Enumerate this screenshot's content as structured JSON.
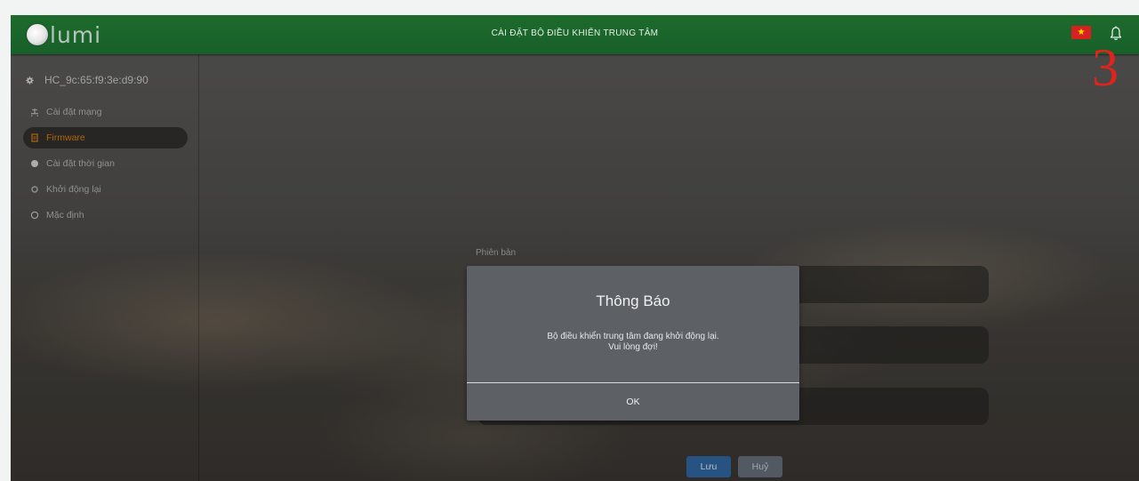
{
  "header": {
    "logo_text": "lumi",
    "title": "CÀI ĐẶT BỘ ĐIỀU KHIỂN TRUNG TÂM",
    "flag": "vietnam-flag-icon",
    "bell": "bell-icon"
  },
  "annotation": {
    "number": "3"
  },
  "sidebar": {
    "device_id": "HC_9c:65:f9:3e:d9:90",
    "items": [
      {
        "label": "Cài đặt mạng",
        "icon": "network-icon",
        "active": false
      },
      {
        "label": "Firmware",
        "icon": "firmware-icon",
        "active": true
      },
      {
        "label": "Cài đặt thời gian",
        "icon": "clock-icon",
        "active": false
      },
      {
        "label": "Khởi động lại",
        "icon": "restart-icon",
        "active": false
      },
      {
        "label": "Mặc định",
        "icon": "reset-icon",
        "active": false
      }
    ]
  },
  "form": {
    "version_label": "Phiên bản",
    "save_label": "Lưu",
    "cancel_label": "Huỷ"
  },
  "dialog": {
    "title": "Thông Báo",
    "message_line1": "Bộ điều khiển trung tâm đang khởi động lại.",
    "message_line2": "Vui lòng đợi!",
    "ok_label": "OK"
  },
  "colors": {
    "header": "#1e6b2c",
    "active_item": "#c8740f",
    "save": "#2c5f93",
    "dialog": "#5d6165",
    "annotation": "#e0241b"
  }
}
